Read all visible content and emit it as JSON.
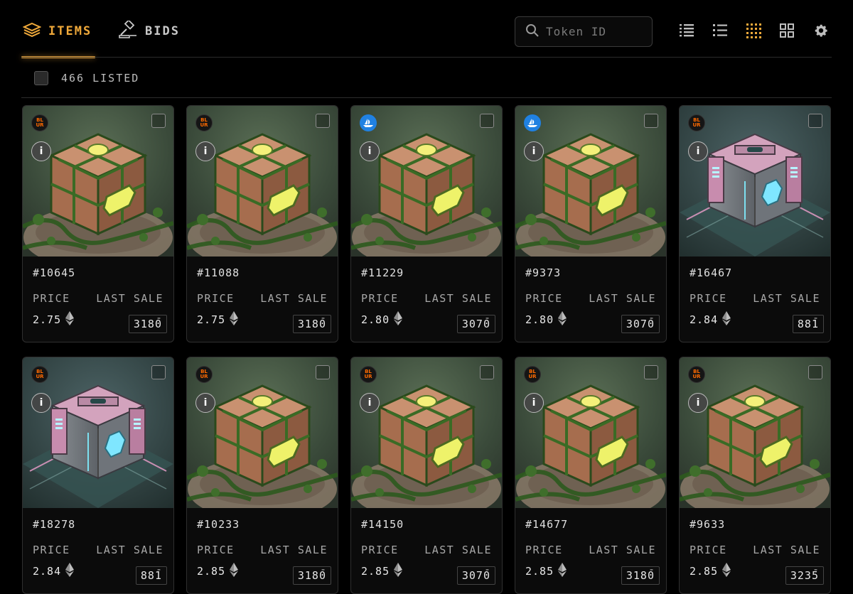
{
  "tabs": {
    "items_label": "ITEMS",
    "bids_label": "BIDS"
  },
  "search": {
    "placeholder": "Token ID"
  },
  "listed": {
    "label": "466 LISTED"
  },
  "labels": {
    "price": "PRICE",
    "last_sale": "LAST SALE"
  },
  "colors": {
    "accent": "#f0a93a",
    "blur_brand": "#ff6a00",
    "opensea_brand": "#2081e2"
  },
  "cards": [
    {
      "token": "#10645",
      "price": "2.75",
      "last_sale": "-",
      "rarity": "3180",
      "market": "blur-icon",
      "art": "green-cube"
    },
    {
      "token": "#11088",
      "price": "2.75",
      "last_sale": "-",
      "rarity": "3180",
      "market": "blur-icon",
      "art": "green-cube"
    },
    {
      "token": "#11229",
      "price": "2.80",
      "last_sale": "-",
      "rarity": "3070",
      "market": "opensea-icon",
      "art": "green-cube"
    },
    {
      "token": "#9373",
      "price": "2.80",
      "last_sale": "-",
      "rarity": "3070",
      "market": "opensea-icon",
      "art": "green-cube"
    },
    {
      "token": "#16467",
      "price": "2.84",
      "last_sale": "-",
      "rarity": "881",
      "market": "blur-icon",
      "art": "pink-crate"
    },
    {
      "token": "#18278",
      "price": "2.84",
      "last_sale": "-",
      "rarity": "881",
      "market": "blur-icon",
      "art": "pink-crate"
    },
    {
      "token": "#10233",
      "price": "2.85",
      "last_sale": "-",
      "rarity": "3180",
      "market": "blur-icon",
      "art": "green-cube"
    },
    {
      "token": "#14150",
      "price": "2.85",
      "last_sale": "-",
      "rarity": "3070",
      "market": "blur-icon",
      "art": "green-cube"
    },
    {
      "token": "#14677",
      "price": "2.85",
      "last_sale": "-",
      "rarity": "3180",
      "market": "blur-icon",
      "art": "green-cube"
    },
    {
      "token": "#9633",
      "price": "2.85",
      "last_sale": "-",
      "rarity": "3235",
      "market": "blur-icon",
      "art": "green-cube"
    }
  ]
}
